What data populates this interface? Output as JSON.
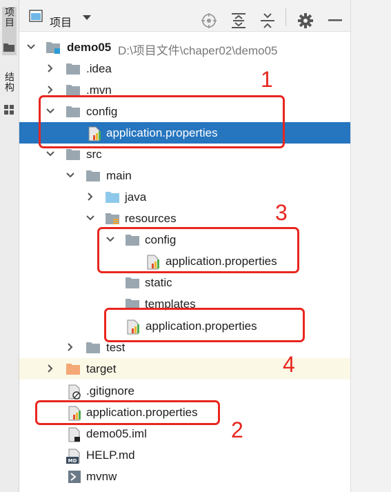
{
  "sidebar": {
    "project_tab": "项目",
    "structure_tab": "结构"
  },
  "toolbar": {
    "title": "项目",
    "icons": [
      "window-icon",
      "dropdown-icon",
      "locate-icon",
      "expand-all-icon",
      "collapse-all-icon",
      "gear-icon",
      "minimize-icon"
    ]
  },
  "tree": {
    "root_name": "demo05",
    "root_path": "D:\\项目文件\\chaper02\\demo05",
    "items": [
      {
        "label": ".idea"
      },
      {
        "label": ".mvn"
      },
      {
        "label": "config"
      },
      {
        "label": "application.properties"
      },
      {
        "label": "src"
      },
      {
        "label": "main"
      },
      {
        "label": "java"
      },
      {
        "label": "resources"
      },
      {
        "label": "config"
      },
      {
        "label": "application.properties"
      },
      {
        "label": "static"
      },
      {
        "label": "templates"
      },
      {
        "label": "application.properties"
      },
      {
        "label": "test"
      },
      {
        "label": "target"
      },
      {
        "label": ".gitignore"
      },
      {
        "label": "application.properties"
      },
      {
        "label": "demo05.iml"
      },
      {
        "label": "HELP.md"
      },
      {
        "label": "mvnw"
      }
    ]
  },
  "annotations": {
    "a1": "1",
    "a2": "2",
    "a3": "3",
    "a4": "4"
  },
  "colors": {
    "selection": "#2675bf",
    "annotation_red": "#e8261f",
    "folder_gray": "#9aa7b0",
    "folder_blue": "#8ec9ec",
    "folder_orange": "#f4a876"
  }
}
